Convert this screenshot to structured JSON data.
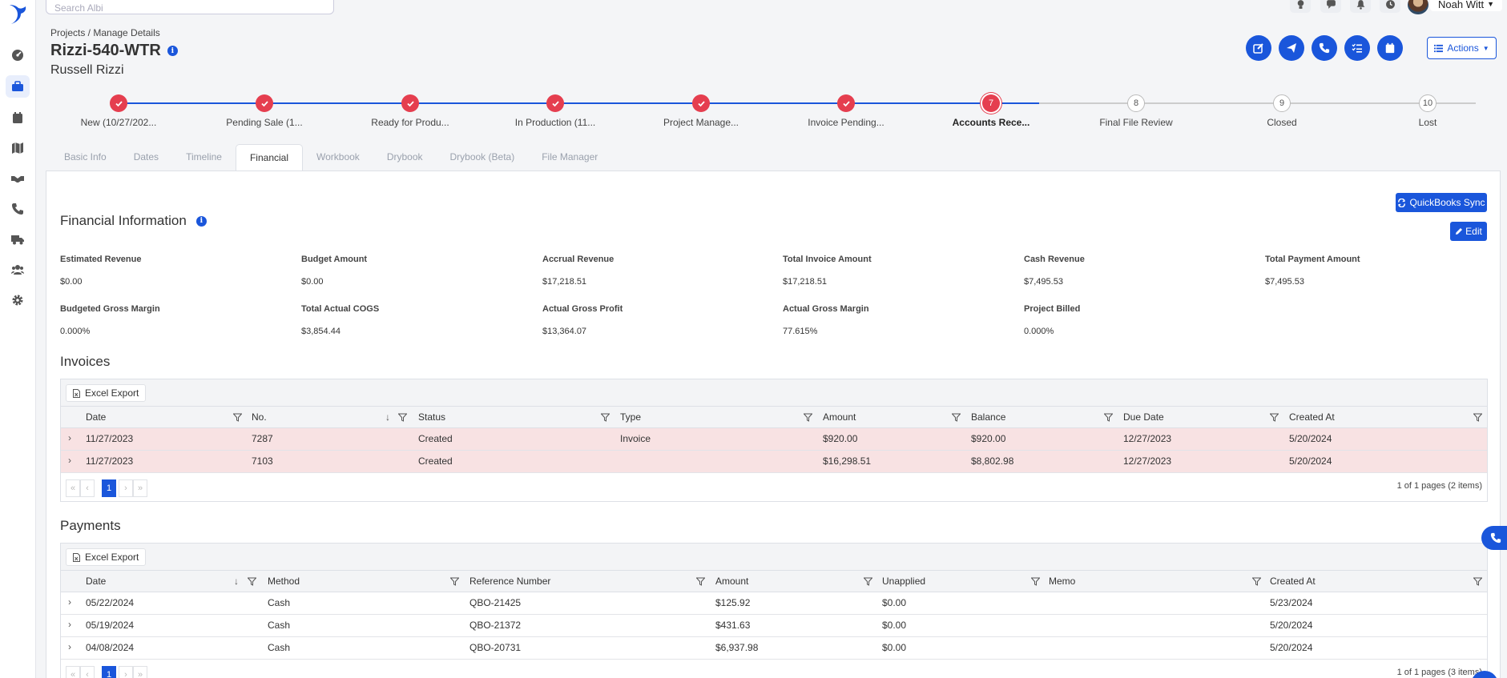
{
  "topbar": {
    "search_placeholder": "Search Albi",
    "user_name": "Noah Witt"
  },
  "header": {
    "breadcrumb": "Projects / Manage Details",
    "project_title": "Rizzi-540-WTR",
    "customer_name": "Russell Rizzi",
    "actions_label": "Actions"
  },
  "stepper": [
    {
      "label": "New (10/27/202...",
      "state": "done"
    },
    {
      "label": "Pending Sale (1...",
      "state": "done"
    },
    {
      "label": "Ready for Produ...",
      "state": "done"
    },
    {
      "label": "In Production (11...",
      "state": "done"
    },
    {
      "label": "Project Manage...",
      "state": "done"
    },
    {
      "label": "Invoice Pending...",
      "state": "done"
    },
    {
      "label": "Accounts Rece...",
      "state": "current",
      "number": "7"
    },
    {
      "label": "Final File Review",
      "state": "todo",
      "number": "8"
    },
    {
      "label": "Closed",
      "state": "todo",
      "number": "9"
    },
    {
      "label": "Lost",
      "state": "todo",
      "number": "10"
    }
  ],
  "tabs": [
    "Basic Info",
    "Dates",
    "Timeline",
    "Financial",
    "Workbook",
    "Drybook",
    "Drybook (Beta)",
    "File Manager"
  ],
  "financial": {
    "title": "Financial Information",
    "quickbooks_label": "QuickBooks Sync",
    "edit_label": "Edit",
    "metrics_row1": [
      {
        "label": "Estimated Revenue",
        "value": "$0.00"
      },
      {
        "label": "Budget Amount",
        "value": "$0.00"
      },
      {
        "label": "Accrual Revenue",
        "value": "$17,218.51"
      },
      {
        "label": "Total Invoice Amount",
        "value": "$17,218.51"
      },
      {
        "label": "Cash Revenue",
        "value": "$7,495.53"
      },
      {
        "label": "Total Payment Amount",
        "value": "$7,495.53"
      }
    ],
    "metrics_row2": [
      {
        "label": "Budgeted Gross Margin",
        "value": "0.000%"
      },
      {
        "label": "Total Actual COGS",
        "value": "$3,854.44"
      },
      {
        "label": "Actual Gross Profit",
        "value": "$13,364.07"
      },
      {
        "label": "Actual Gross Margin",
        "value": "77.615%"
      },
      {
        "label": "Project Billed",
        "value": "0.000%"
      }
    ]
  },
  "invoices": {
    "title": "Invoices",
    "export_label": "Excel Export",
    "columns": [
      "Date",
      "No.",
      "Status",
      "Type",
      "Amount",
      "Balance",
      "Due Date",
      "Created At"
    ],
    "rows": [
      [
        "11/27/2023",
        "7287",
        "Created",
        "Invoice",
        "$920.00",
        "$920.00",
        "12/27/2023",
        "5/20/2024"
      ],
      [
        "11/27/2023",
        "7103",
        "Created",
        "",
        "$16,298.51",
        "$8,802.98",
        "12/27/2023",
        "5/20/2024"
      ]
    ],
    "page": "1",
    "pager_info": "1 of 1 pages (2 items)"
  },
  "payments": {
    "title": "Payments",
    "export_label": "Excel Export",
    "columns": [
      "Date",
      "Method",
      "Reference Number",
      "Amount",
      "Unapplied",
      "Memo",
      "Created At"
    ],
    "rows": [
      [
        "05/22/2024",
        "Cash",
        "QBO-21425",
        "$125.92",
        "$0.00",
        "",
        "5/23/2024"
      ],
      [
        "05/19/2024",
        "Cash",
        "QBO-21372",
        "$431.63",
        "$0.00",
        "",
        "5/20/2024"
      ],
      [
        "04/08/2024",
        "Cash",
        "QBO-20731",
        "$6,937.98",
        "$0.00",
        "",
        "5/20/2024"
      ]
    ],
    "page": "1",
    "pager_info": "1 of 1 pages (3 items)"
  },
  "colors": {
    "accent": "#1a56db",
    "step_done": "#e53e4f",
    "row_highlight": "#f8e2e3"
  }
}
